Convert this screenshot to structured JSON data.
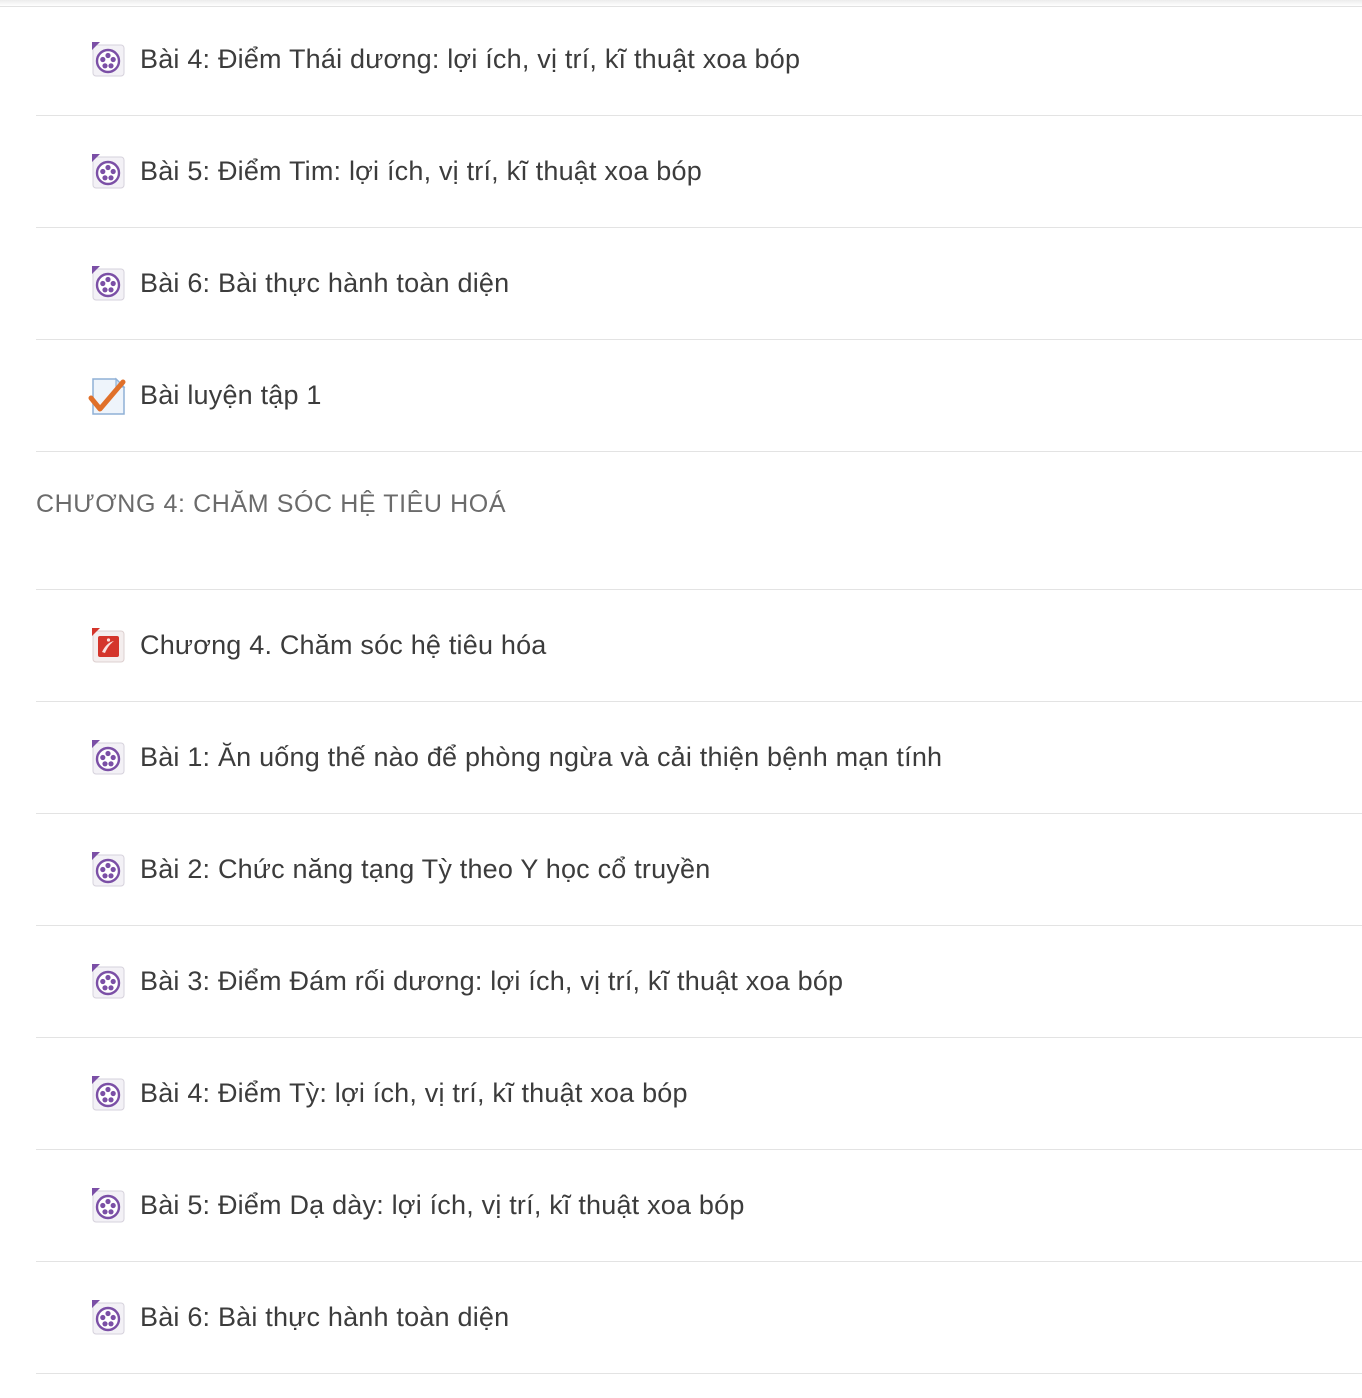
{
  "groups": [
    {
      "items": [
        {
          "icon": "video-icon",
          "label": "Bài 4: Điểm Thái dương: lợi ích, vị trí, kĩ thuật xoa bóp"
        },
        {
          "icon": "video-icon",
          "label": "Bài 5: Điểm Tim: lợi ích, vị trí, kĩ thuật xoa bóp"
        },
        {
          "icon": "video-icon",
          "label": "Bài 6: Bài thực hành toàn diện"
        },
        {
          "icon": "quiz-icon",
          "label": "Bài luyện tập 1"
        }
      ]
    }
  ],
  "section": {
    "title": "CHƯƠNG 4: CHĂM SÓC HỆ TIÊU HOÁ",
    "items": [
      {
        "icon": "pdf-icon",
        "label": "Chương 4. Chăm sóc hệ tiêu hóa"
      },
      {
        "icon": "video-icon",
        "label": "Bài 1: Ăn uống thế nào để phòng ngừa và cải thiện bệnh mạn tính"
      },
      {
        "icon": "video-icon",
        "label": "Bài 2: Chức năng tạng Tỳ theo Y học cổ truyền"
      },
      {
        "icon": "video-icon",
        "label": "Bài 3: Điểm Đám rối dương: lợi ích, vị trí, kĩ thuật xoa bóp"
      },
      {
        "icon": "video-icon",
        "label": "Bài 4: Điểm Tỳ: lợi ích, vị trí, kĩ thuật xoa bóp"
      },
      {
        "icon": "video-icon",
        "label": "Bài 5: Điểm Dạ dày: lợi ích, vị trí, kĩ thuật xoa bóp"
      },
      {
        "icon": "video-icon",
        "label": "Bài 6: Bài thực hành toàn diện"
      }
    ]
  },
  "colors": {
    "text": "#3c3c3c",
    "section_title": "#6b6b6b",
    "divider": "#e3e3e3",
    "video_icon": "#7b4fa6",
    "pdf_icon": "#d4352b",
    "quiz_check": "#e0702a"
  }
}
